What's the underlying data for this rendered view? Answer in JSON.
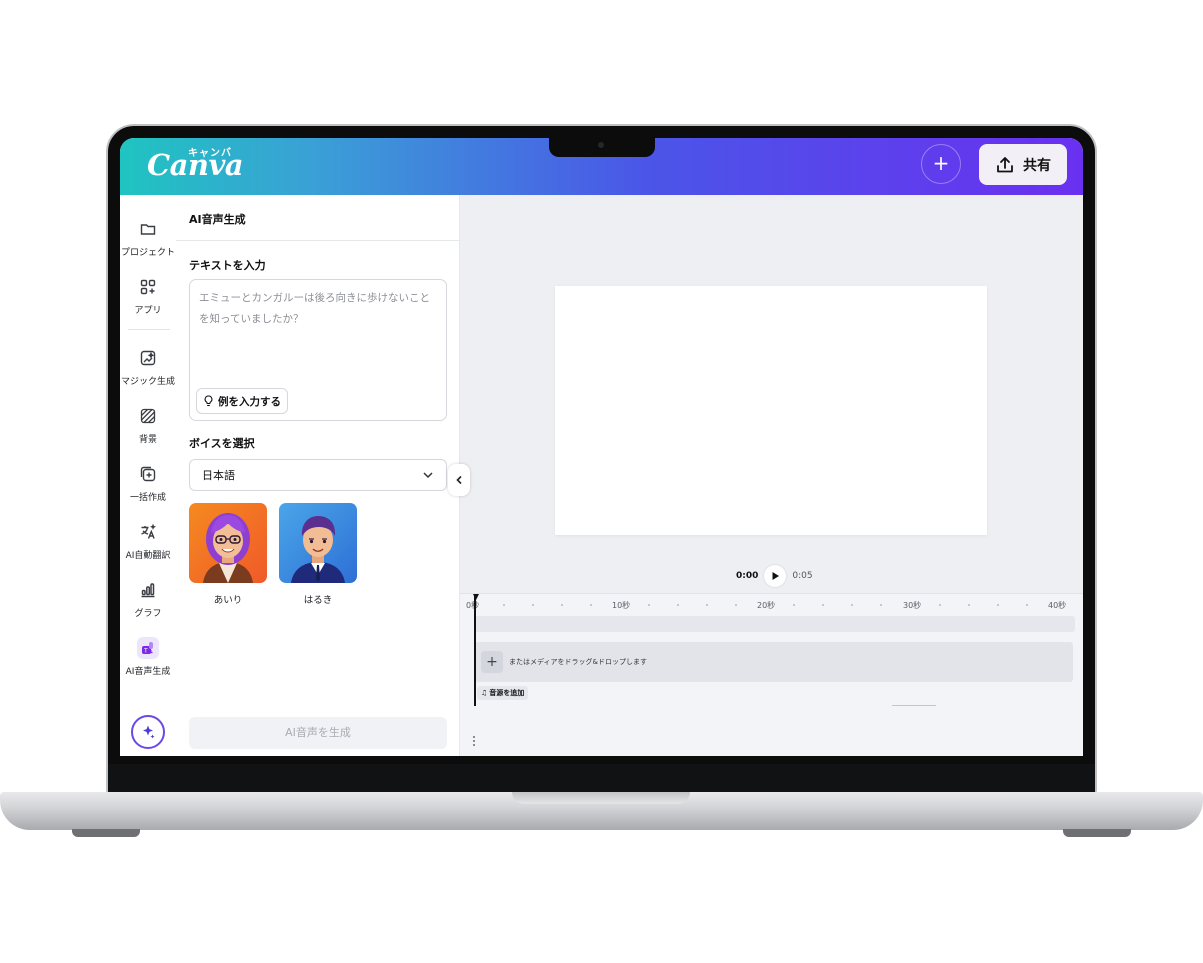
{
  "app": {
    "logo": "Canva",
    "logo_sub": "キャンバ"
  },
  "topbar": {
    "share_label": "共有"
  },
  "rail": {
    "items": [
      {
        "label": "プロジェクト",
        "icon": "folder-icon"
      },
      {
        "label": "アプリ",
        "icon": "apps-icon"
      },
      {
        "label": "マジック生成",
        "icon": "magic-media-icon"
      },
      {
        "label": "背景",
        "icon": "background-icon"
      },
      {
        "label": "一括作成",
        "icon": "bulk-create-icon"
      },
      {
        "label": "AI自動翻訳",
        "icon": "translate-icon"
      },
      {
        "label": "グラフ",
        "icon": "chart-icon"
      },
      {
        "label": "AI音声生成",
        "icon": "ai-voice-icon"
      }
    ]
  },
  "panel": {
    "title": "AI音声生成",
    "text_section": "テキストを入力",
    "text_placeholder": "エミューとカンガルーは後ろ向きに歩けないことを知っていましたか？",
    "example_button": "例を入力する",
    "voice_section": "ボイスを選択",
    "language_selected": "日本語",
    "voices": [
      {
        "name": "あいり"
      },
      {
        "name": "はるき"
      }
    ],
    "generate_button": "AI音声を生成"
  },
  "player": {
    "current_time": "0:00",
    "total_time": "0:05"
  },
  "timeline": {
    "ticks": [
      "0秒",
      "10秒",
      "20秒",
      "30秒",
      "40秒"
    ],
    "drop_hint": "またはメディアをドラッグ&ドロップします",
    "add_audio": "音源を追加"
  },
  "colors": {
    "accent": "#7d2ae8",
    "header_start": "#1fc4c1",
    "header_end": "#6a30f0"
  }
}
